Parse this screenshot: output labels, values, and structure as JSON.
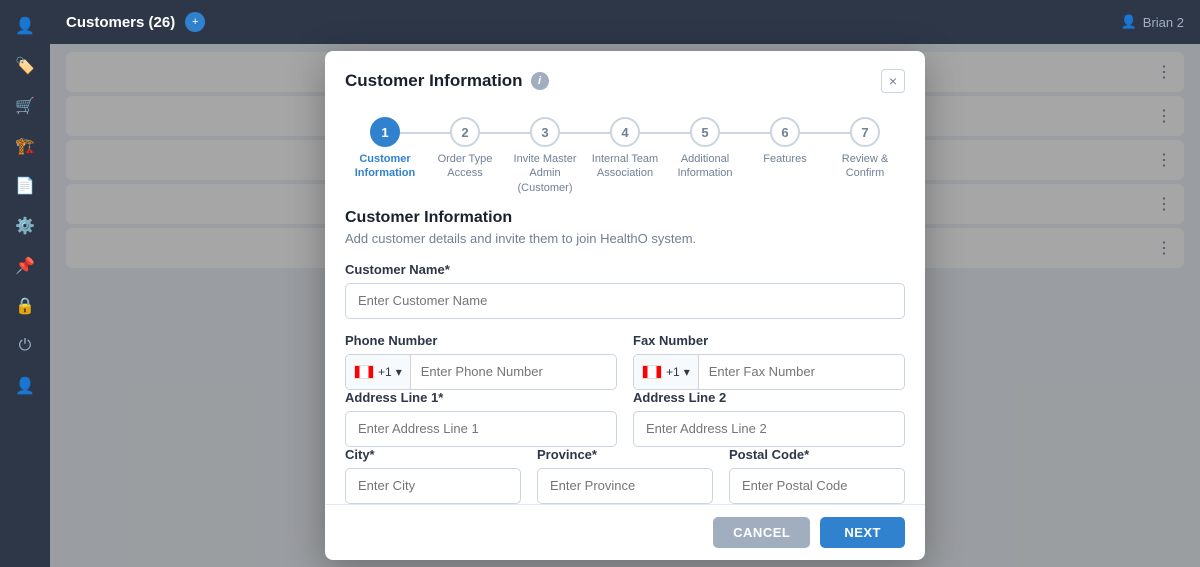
{
  "app": {
    "title": "Customers (26)",
    "badge": "+",
    "user": "Brian 2"
  },
  "sidebar": {
    "icons": [
      "👤",
      "🏷️",
      "🛒",
      "🏗️",
      "📄",
      "⚙️",
      "📌",
      "🔒",
      "⏻",
      "👤"
    ]
  },
  "modal": {
    "title": "Customer Information",
    "info_icon": "i",
    "close_label": "×",
    "steps": [
      {
        "number": "1",
        "label": "Customer\nInformation",
        "active": true
      },
      {
        "number": "2",
        "label": "Order Type Access",
        "active": false
      },
      {
        "number": "3",
        "label": "Invite Master\nAdmin (Customer)",
        "active": false
      },
      {
        "number": "4",
        "label": "Internal Team\nAssociation",
        "active": false
      },
      {
        "number": "5",
        "label": "Additional\nInformation",
        "active": false
      },
      {
        "number": "6",
        "label": "Features",
        "active": false
      },
      {
        "number": "7",
        "label": "Review & Confirm",
        "active": false
      }
    ],
    "section_title": "Customer Information",
    "section_desc": "Add customer details and invite them to join HealthO system.",
    "form": {
      "customer_name_label": "Customer Name*",
      "customer_name_placeholder": "Enter Customer Name",
      "phone_label": "Phone Number",
      "phone_code": "+1",
      "phone_placeholder": "Enter Phone Number",
      "fax_label": "Fax Number",
      "fax_code": "+1",
      "fax_placeholder": "Enter Fax Number",
      "address1_label": "Address Line 1*",
      "address1_placeholder": "Enter Address Line 1",
      "address2_label": "Address Line 2",
      "address2_placeholder": "Enter Address Line 2",
      "city_label": "City*",
      "city_placeholder": "Enter City",
      "province_label": "Province*",
      "province_placeholder": "Enter Province",
      "postal_label": "Postal Code*",
      "postal_placeholder": "Enter Postal Code"
    },
    "footer": {
      "cancel_label": "CANCEL",
      "next_label": "NEXT"
    }
  }
}
